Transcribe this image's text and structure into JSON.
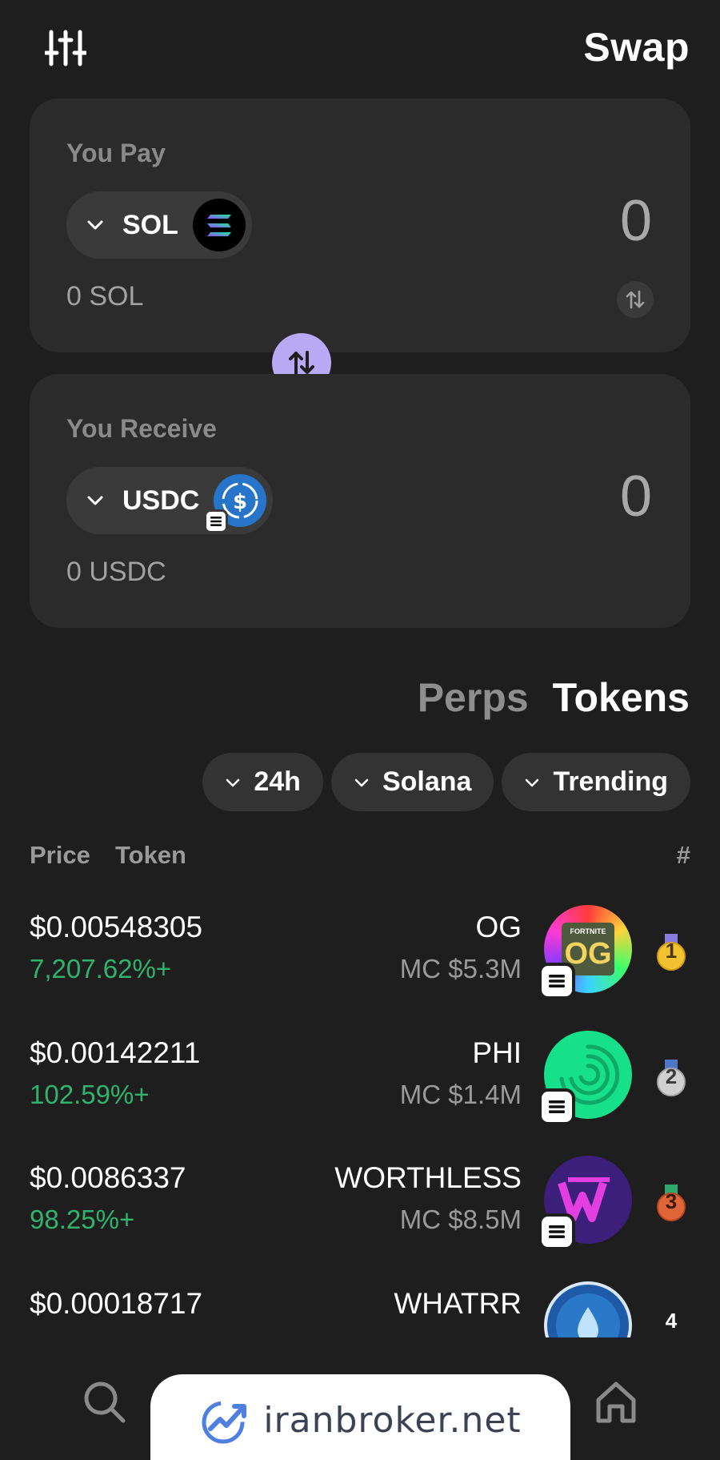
{
  "header": {
    "title": "Swap",
    "settings_icon": "sliders-icon"
  },
  "pay": {
    "label": "You Pay",
    "token": "SOL",
    "amount": "0",
    "balance": "0 SOL",
    "token_icon": "solana-icon"
  },
  "receive": {
    "label": "You Receive",
    "token": "USDC",
    "amount": "0",
    "balance": "0 USDC",
    "token_icon": "usdc-icon"
  },
  "tabs": {
    "perps": "Perps",
    "tokens": "Tokens",
    "active": "Tokens"
  },
  "filters": {
    "timeframe": "24h",
    "chain": "Solana",
    "sort": "Trending"
  },
  "list_head": {
    "price": "Price",
    "token": "Token",
    "rank": "#"
  },
  "tokens": [
    {
      "price": "$0.00548305",
      "change": "7,207.62%+",
      "name": "OG",
      "mc": "MC $5.3M",
      "rank": "1",
      "logo_text": "OG",
      "logo_caption": "FORTNITE"
    },
    {
      "price": "$0.00142211",
      "change": "102.59%+",
      "name": "PHI",
      "mc": "MC $1.4M",
      "rank": "2"
    },
    {
      "price": "$0.0086337",
      "change": "98.25%+",
      "name": "WORTHLESS",
      "mc": "MC $8.5M",
      "rank": "3"
    },
    {
      "price": "$0.00018717",
      "change": "",
      "name": "WHATRR",
      "mc": "",
      "rank": "4"
    }
  ],
  "colors": {
    "background": "#1e1e1e",
    "card": "#2b2b2b",
    "accent": "#b8a9f5",
    "positive": "#2fb36d"
  },
  "watermark": {
    "text": "iranbroker.net"
  },
  "nav": [
    "search-icon",
    "clock-icon",
    "swap-arrow-icon",
    "home-icon"
  ]
}
